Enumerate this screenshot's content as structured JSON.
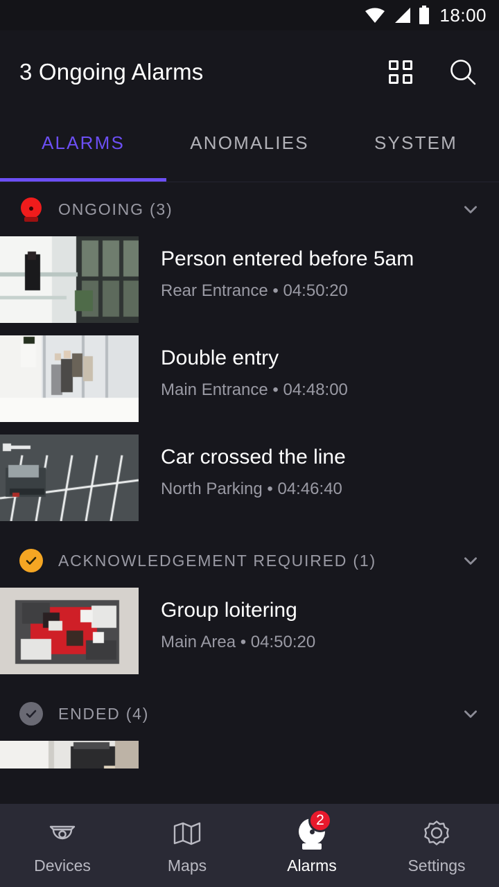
{
  "status_bar": {
    "time": "18:00",
    "wifi_icon": "wifi-icon",
    "signal_icon": "cellular-signal-icon",
    "battery_icon": "battery-full-icon"
  },
  "app_bar": {
    "title": "3 Ongoing Alarms",
    "grid_icon": "grid-view-icon",
    "search_icon": "search-icon"
  },
  "tabs": {
    "active_index": 0,
    "accent_color": "#6C4FF5",
    "items": [
      {
        "label": "ALARMS"
      },
      {
        "label": "ANOMALIES"
      },
      {
        "label": "SYSTEM"
      }
    ]
  },
  "sections": [
    {
      "label": "ONGOING (3)",
      "status": "ongoing",
      "status_color": "#F01C1C",
      "status_icon": "siren-red-icon",
      "chevron_icon": "chevron-down-icon",
      "expanded": true,
      "alarms": [
        {
          "title": "Person entered before 5am",
          "location": "Rear Entrance",
          "time": "04:50:20",
          "subtitle": "Rear Entrance • 04:50:20",
          "thumbnail": "woman-on-glass-staircase"
        },
        {
          "title": "Double entry",
          "location": "Main Entrance",
          "time": "04:48:00",
          "subtitle": "Main Entrance • 04:48:00",
          "thumbnail": "group-entering-lobby"
        },
        {
          "title": "Car crossed the line",
          "location": "North Parking",
          "time": "04:46:40",
          "subtitle": "North Parking • 04:46:40",
          "thumbnail": "car-in-parking-lot"
        }
      ]
    },
    {
      "label": "ACKNOWLEDGEMENT REQUIRED (1)",
      "status": "acknowledgement",
      "status_color": "#F5A623",
      "status_icon": "check-circle-amber-icon",
      "chevron_icon": "chevron-down-icon",
      "expanded": true,
      "alarms": [
        {
          "title": "Group loitering",
          "location": "Main Area",
          "time": "04:50:20",
          "subtitle": "Main Area • 04:50:20",
          "thumbnail": "people-on-lounge-sofas"
        }
      ]
    },
    {
      "label": "ENDED (4)",
      "status": "ended",
      "status_color": "#6A6A74",
      "status_icon": "check-circle-gray-icon",
      "chevron_icon": "chevron-down-icon",
      "expanded": true,
      "alarms": [
        {
          "title": "",
          "location": "",
          "time": "",
          "subtitle": "",
          "thumbnail": "partially-visible-interior"
        }
      ]
    }
  ],
  "bottom_nav": {
    "active_index": 2,
    "items": [
      {
        "label": "Devices",
        "icon": "dome-camera-icon",
        "badge": ""
      },
      {
        "label": "Maps",
        "icon": "folded-map-icon",
        "badge": ""
      },
      {
        "label": "Alarms",
        "icon": "siren-white-icon",
        "badge": "2"
      },
      {
        "label": "Settings",
        "icon": "gear-icon",
        "badge": ""
      }
    ],
    "badge_color": "#E8192C"
  }
}
